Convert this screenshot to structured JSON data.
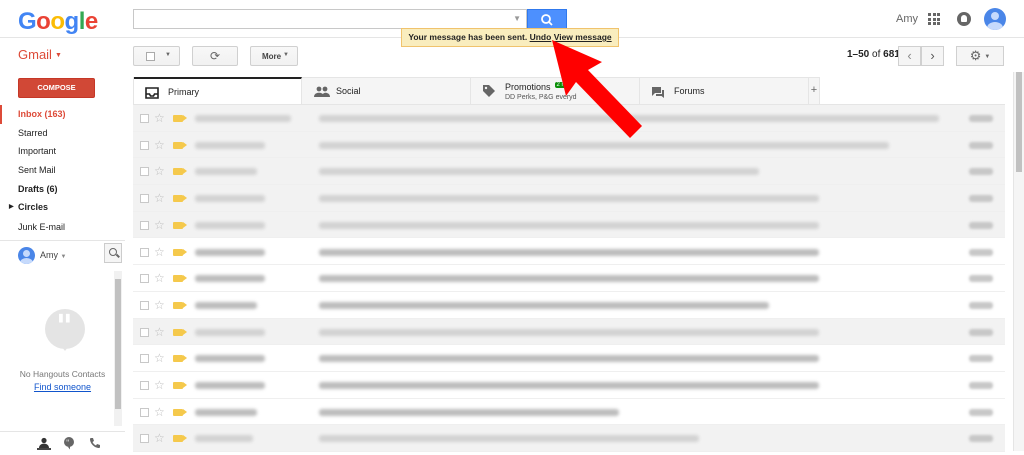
{
  "topbar": {
    "logo_letters": [
      "G",
      "o",
      "o",
      "g",
      "l",
      "e"
    ],
    "logo_colors": [
      "#4285f4",
      "#ea4335",
      "#fbbc05",
      "#4285f4",
      "#34a853",
      "#ea4335"
    ],
    "search_placeholder": "",
    "user_name": "Amy",
    "icons": [
      "search-icon",
      "apps-grid-icon",
      "notifications-icon",
      "account-avatar-icon"
    ]
  },
  "toolbar": {
    "app_label": "Gmail",
    "refresh_glyph": "⟳",
    "more_label": "More",
    "range": "1–50",
    "of_label": "of",
    "total": "681",
    "prev_glyph": "‹",
    "next_glyph": "›",
    "settings_glyph": "⚙"
  },
  "toast": {
    "message": "Your message has been sent.",
    "undo": "Undo",
    "view": "View message"
  },
  "sidebar": {
    "compose_label": "COMPOSE",
    "items": [
      {
        "label": "Inbox (163)",
        "state": "active"
      },
      {
        "label": "Starred",
        "state": "normal"
      },
      {
        "label": "Important",
        "state": "normal"
      },
      {
        "label": "Sent Mail",
        "state": "normal"
      },
      {
        "label": "Drafts (6)",
        "state": "bold"
      },
      {
        "label": "Circles",
        "state": "bold"
      }
    ],
    "junk_label": "Junk E-mail"
  },
  "hangouts": {
    "user_name": "Amy",
    "empty_text": "No Hangouts Contacts",
    "find_link": "Find someone"
  },
  "tabs": [
    {
      "label": "Primary",
      "icon": "inbox-icon",
      "selected": true,
      "sub": "",
      "badge": ""
    },
    {
      "label": "Social",
      "icon": "people-icon",
      "selected": false,
      "sub": "",
      "badge": ""
    },
    {
      "label": "Promotions",
      "icon": "tag-icon",
      "selected": false,
      "sub": "DD Perks, P&G everyd",
      "badge": "2 ne"
    },
    {
      "label": "Forums",
      "icon": "chat-icon",
      "selected": false,
      "sub": "",
      "badge": ""
    }
  ],
  "tab_add_label": "+",
  "email_list": {
    "row_count": 13,
    "content_visible": false,
    "unread_rows": [
      5,
      6,
      7,
      9,
      10,
      11
    ]
  },
  "annotation": {
    "type": "red-arrow",
    "color": "#ff0000",
    "points_to": "toast-undo-link"
  },
  "colors": {
    "compose": "#d14836",
    "search_button": "#4d90fe",
    "active_nav": "#dd4b39",
    "toast_bg": "#f9edbe",
    "toast_border": "#f0c36d"
  }
}
